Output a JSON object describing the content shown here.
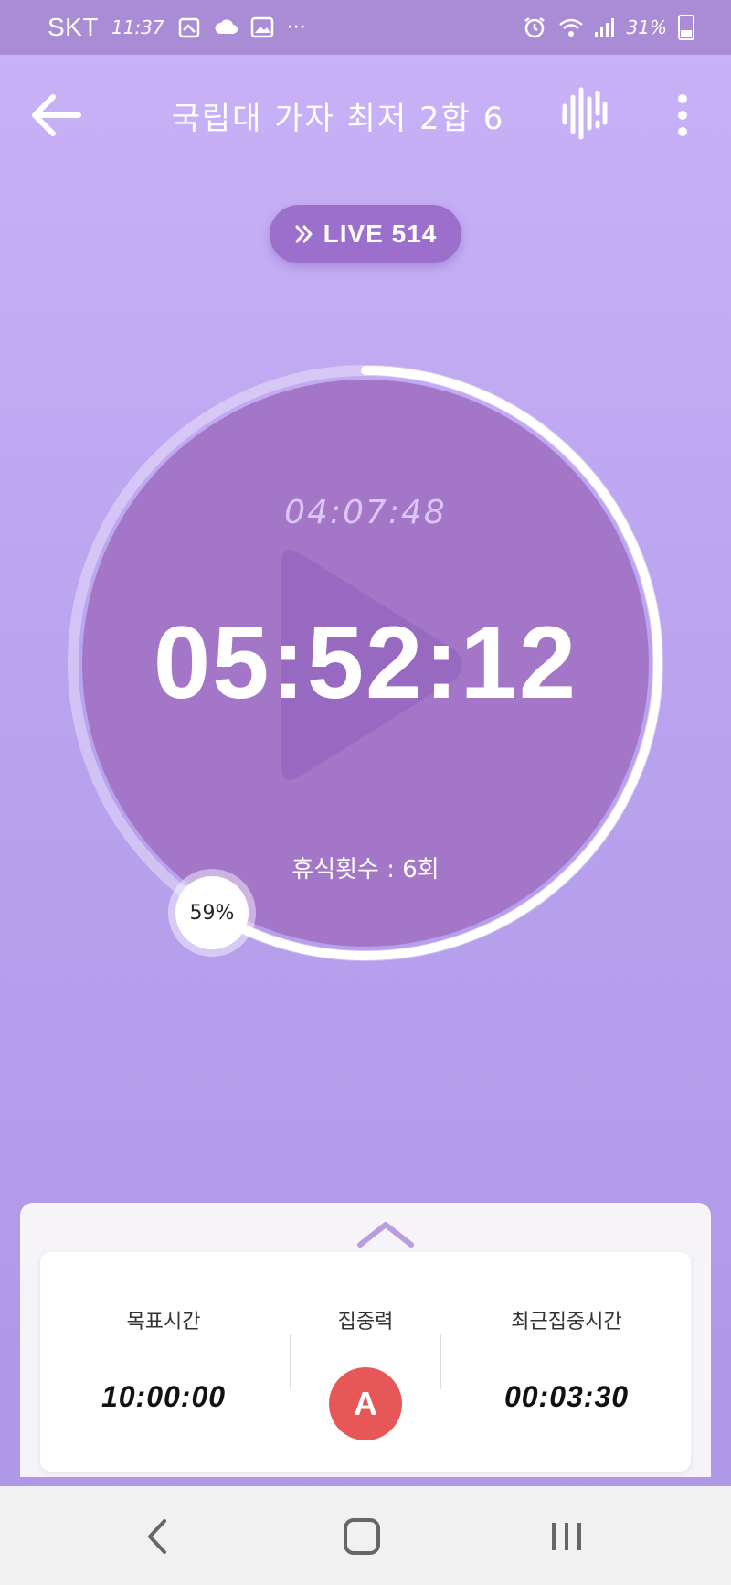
{
  "status_bar": {
    "carrier": "SKT",
    "time": "11:37",
    "more": "···",
    "battery": "31%",
    "icons": [
      "calendar-icon",
      "cloud-icon",
      "image-icon",
      "alarm-icon",
      "wifi-icon",
      "signal-icon",
      "battery-icon"
    ]
  },
  "header": {
    "title": "국립대 가자 최저 2합 6"
  },
  "live": {
    "label": "LIVE 514"
  },
  "timer": {
    "sub_time": "04:07:48",
    "main_time": "05:52:12",
    "break_label": "휴식횟수 : 6회",
    "progress_label": "59%",
    "progress_fraction": 0.59
  },
  "stats": {
    "goal_label": "목표시간",
    "goal_value": "10:00:00",
    "focus_label": "집중력",
    "focus_grade": "A",
    "recent_label": "최근집중시간",
    "recent_value": "00:03:30"
  },
  "colors": {
    "accent": "#9d6fcc",
    "circle": "#a376c8",
    "grade_bg": "#e85757"
  }
}
